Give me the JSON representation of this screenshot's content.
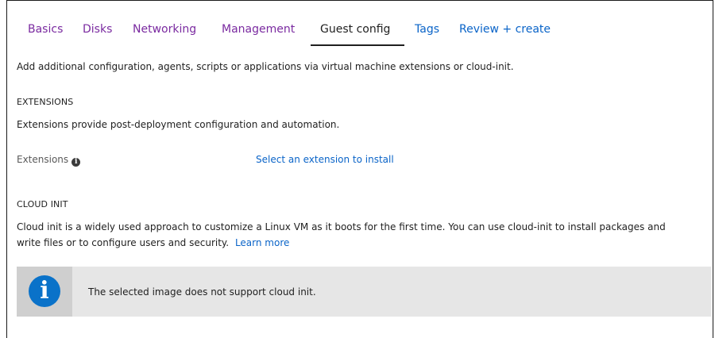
{
  "tabs": [
    {
      "label": "Basics",
      "state": "visited"
    },
    {
      "label": "Disks",
      "state": "visited"
    },
    {
      "label": "Networking",
      "state": "visited"
    },
    {
      "label": "Management",
      "state": "visited"
    },
    {
      "label": "Guest config",
      "state": "active"
    },
    {
      "label": "Tags",
      "state": "link"
    },
    {
      "label": "Review + create",
      "state": "link"
    }
  ],
  "intro": "Add additional configuration, agents, scripts or applications via virtual machine extensions or cloud-init.",
  "extensions": {
    "heading": "EXTENSIONS",
    "description": "Extensions provide post-deployment configuration and automation.",
    "field_label": "Extensions",
    "field_icon": "info-icon",
    "select_link": "Select an extension to install"
  },
  "cloud_init": {
    "heading": "CLOUD INIT",
    "description_line1": "Cloud init is a widely used approach to customize a Linux VM as it boots for the first time. You can use cloud-init to install packages and",
    "description_line2": "write files or to configure users and security.",
    "learn_more": "Learn more"
  },
  "banner": {
    "icon": "info-icon",
    "message": "The selected image does not support cloud init."
  },
  "colors": {
    "visited_tab": "#7a2aa0",
    "link": "#0a64c8",
    "info_blue": "#0a72c9",
    "banner_bg": "#e6e6e6"
  }
}
